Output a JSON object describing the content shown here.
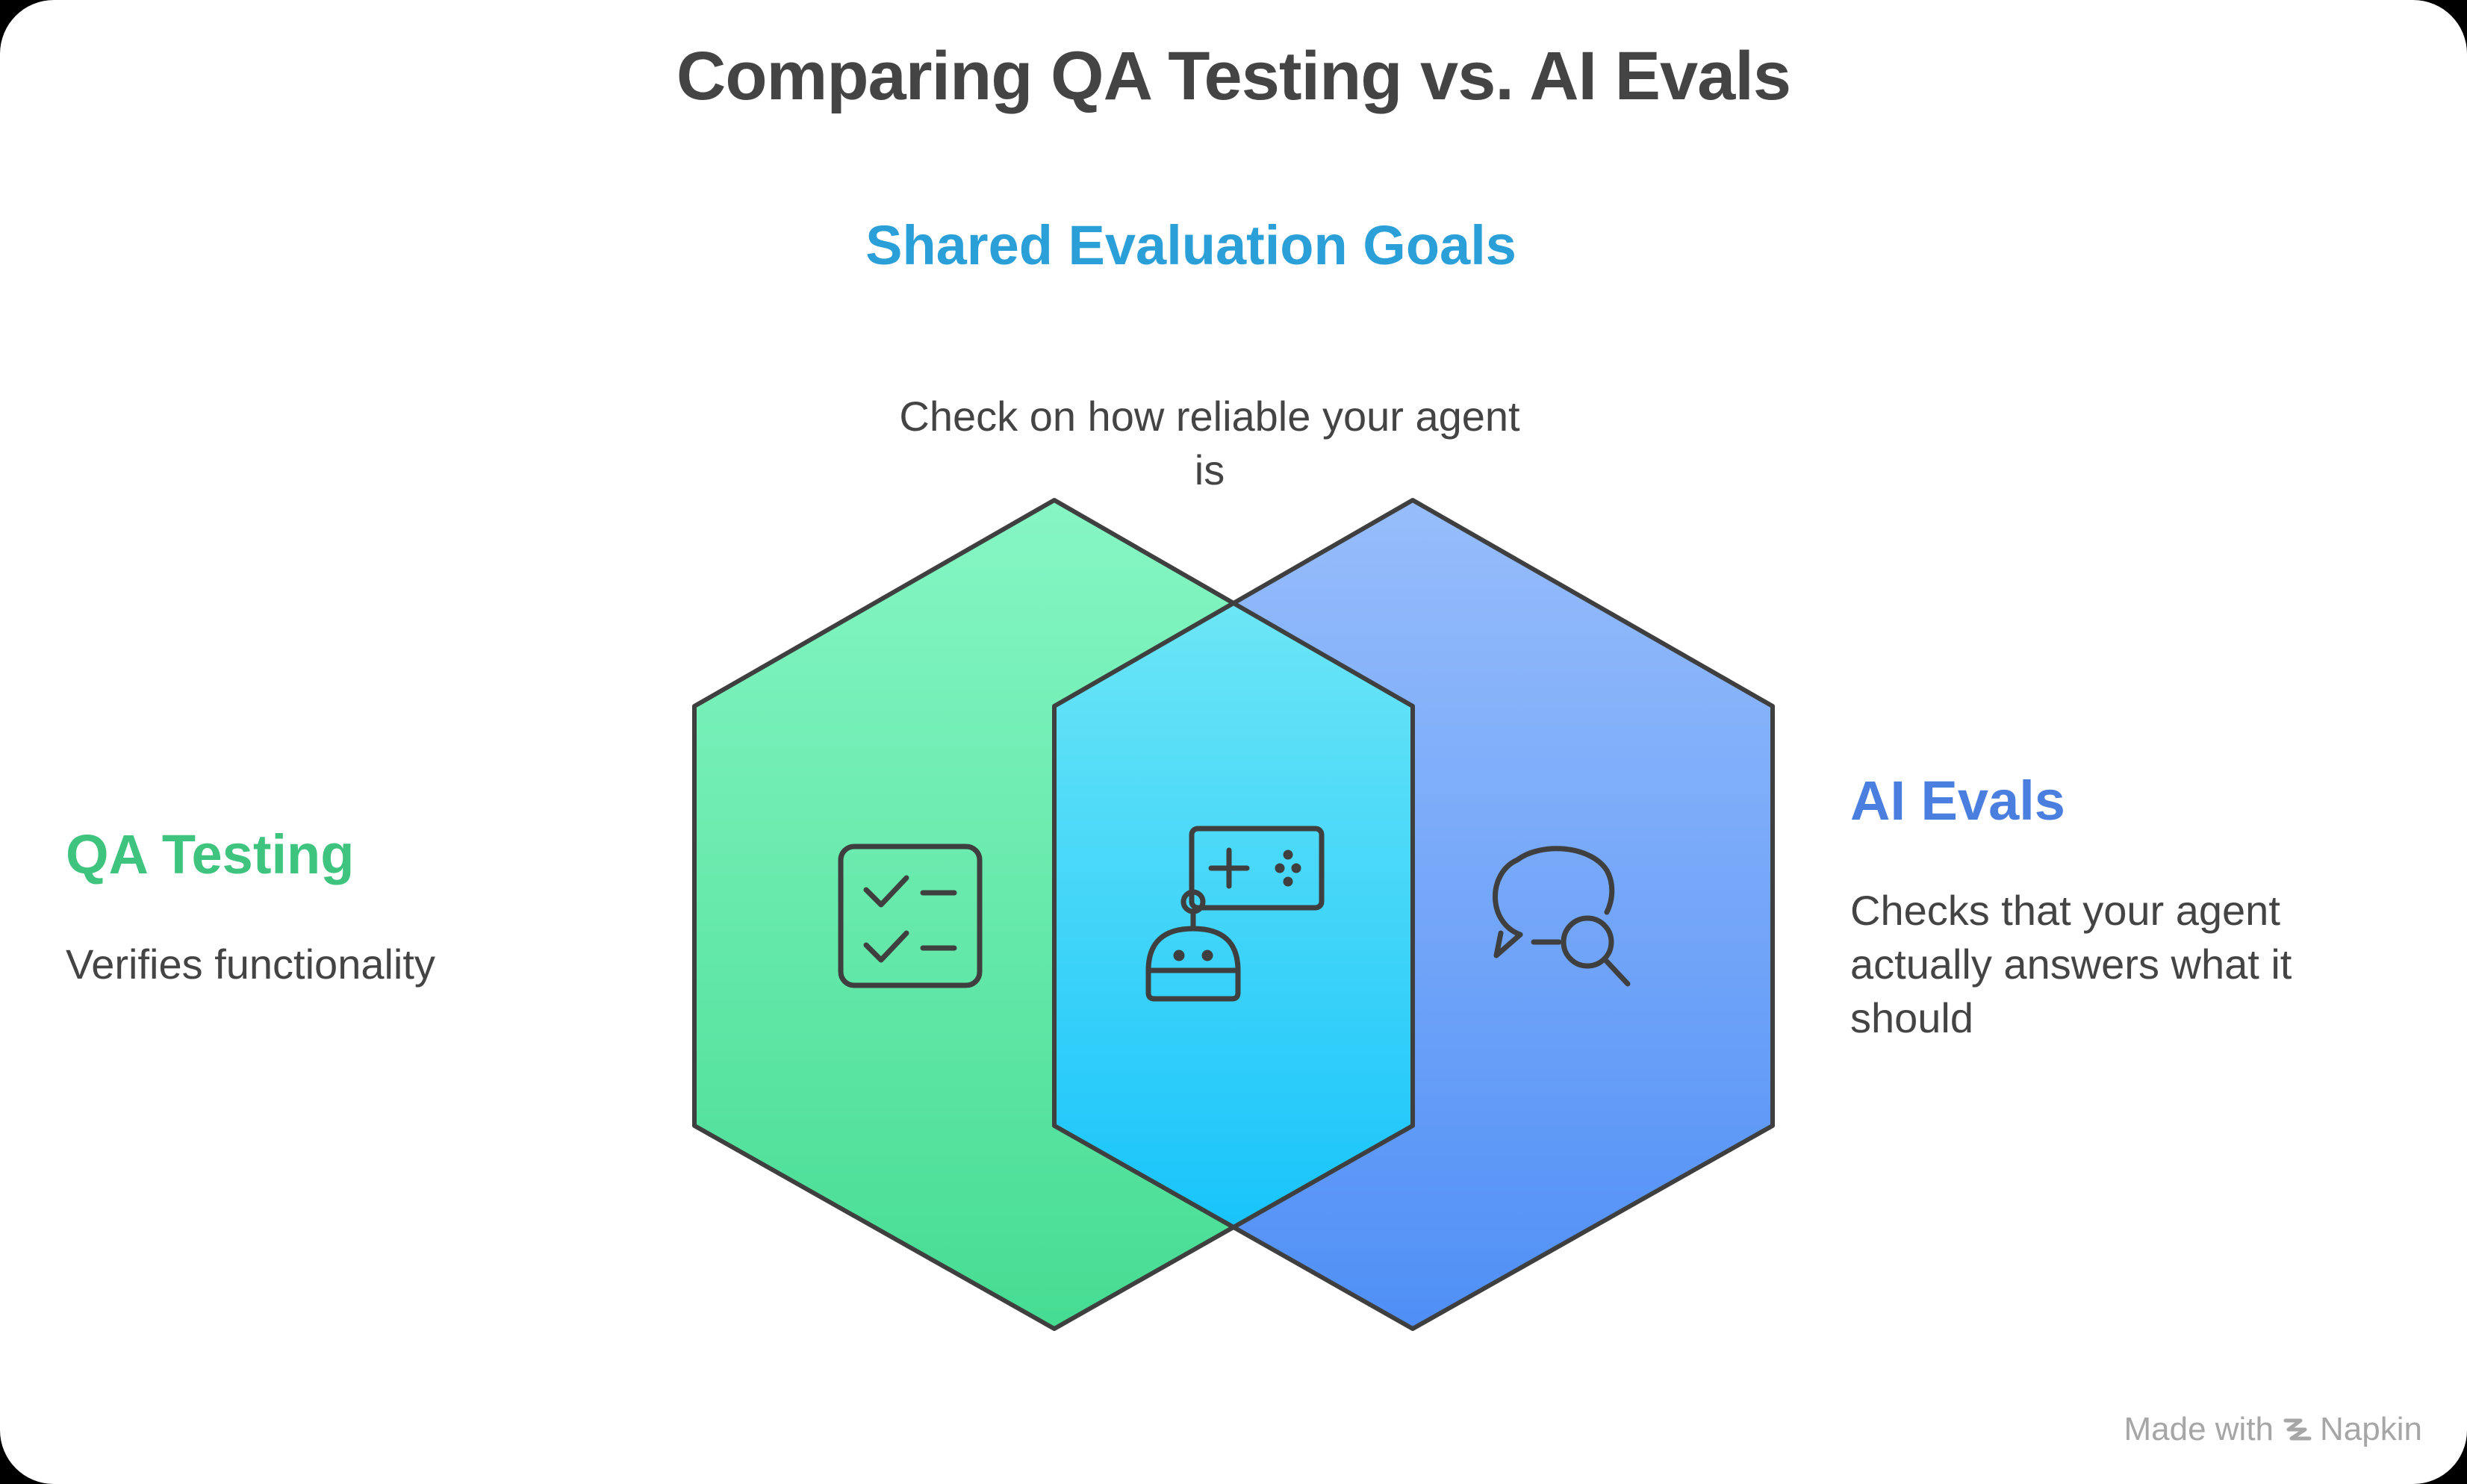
{
  "title": "Comparing QA Testing vs. AI Evals",
  "shared": {
    "title": "Shared Evaluation Goals",
    "description": "Check on how reliable your agent is",
    "icon": "robot-game-icon"
  },
  "qa": {
    "title": "QA Testing",
    "description": "Verifies functionality",
    "icon": "checklist-icon",
    "color": "#3ec47e"
  },
  "ai": {
    "title": "AI Evals",
    "description": "Checks that your agent actually answers what it should",
    "icon": "chat-search-icon",
    "color": "#4a7fe0"
  },
  "colors": {
    "shared": "#2a9fd8",
    "green_fill_top": "#86f6c4",
    "green_fill_bottom": "#46dc92",
    "blue_fill_top": "#97bdfb",
    "blue_fill_bottom": "#4f8ff6",
    "overlap_fill_top": "#6ce6f6",
    "overlap_fill_bottom": "#18c4fb",
    "stroke": "#3f3f3f"
  },
  "footer": {
    "made_with": "Made with",
    "brand": "Napkin"
  }
}
